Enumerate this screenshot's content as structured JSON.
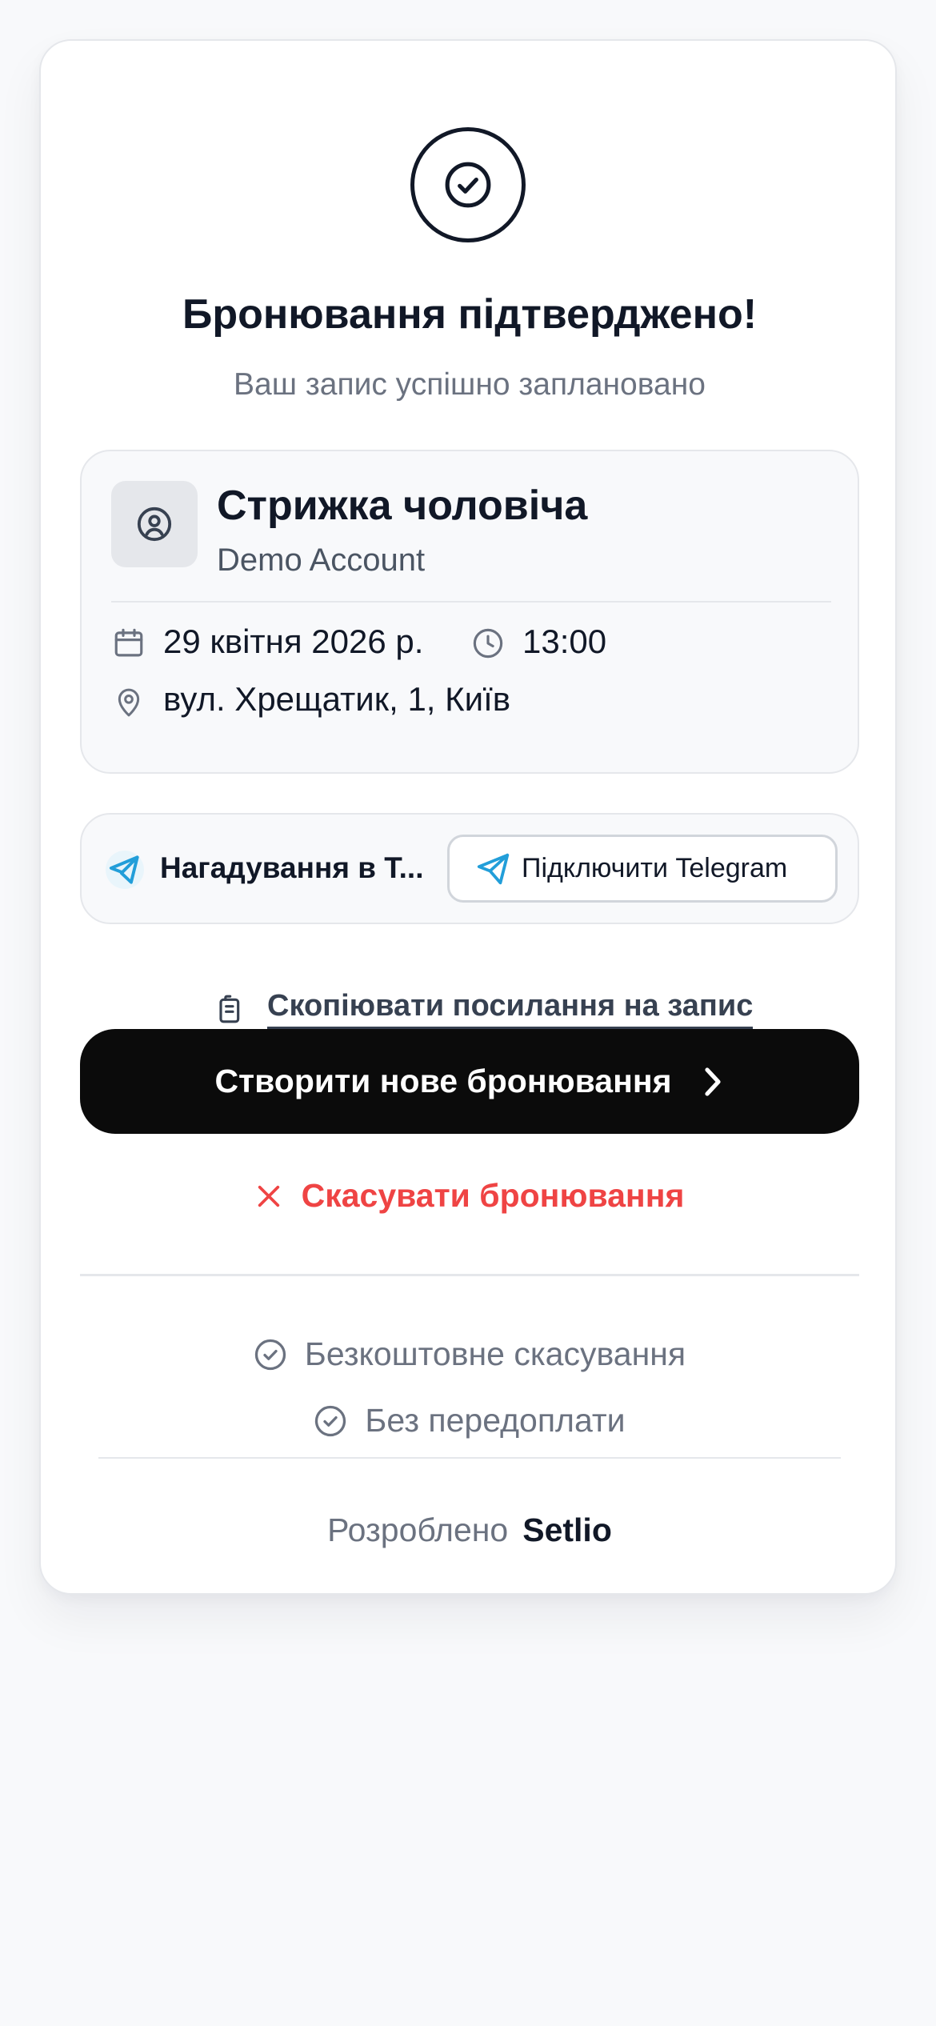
{
  "confirmation": {
    "title": "Бронювання підтверджено!",
    "subtitle": "Ваш запис успішно заплановано"
  },
  "booking": {
    "service": "Стрижка чоловіча",
    "business": "Demo Account",
    "date": "29 квітня 2026 р.",
    "time": "13:00",
    "address": "вул. Хрещатик, 1, Київ"
  },
  "telegram": {
    "label": "Нагадування в Т...",
    "connect_label": "Підключити Telegram",
    "accent": "#229ED9"
  },
  "actions": {
    "copy_link_label": "Скопіювати посилання на запис",
    "new_booking_label": "Створити нове бронювання",
    "cancel_label": "Скасувати бронювання",
    "cancel_color": "#ef4444"
  },
  "features": [
    "Безкоштовне скасування",
    "Без передоплати"
  ],
  "footer": {
    "powered_by": "Розроблено",
    "brand": "Setlio"
  }
}
